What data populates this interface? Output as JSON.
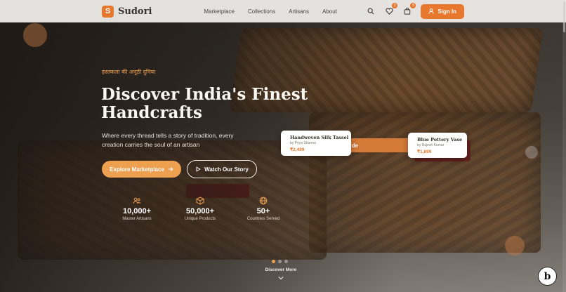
{
  "nav": {
    "logo_letter": "S",
    "brand": "Sudori",
    "links": [
      "Marketplace",
      "Collections",
      "Artisans",
      "About"
    ],
    "wishlist_count": "2",
    "cart_count": "3",
    "signin_label": "Sign In"
  },
  "hero": {
    "eyebrow": "हस्तकला की अनूठी दुनिया",
    "title": "Discover India's Finest Handcrafts",
    "subtitle": "Where every thread tells a story of tradition, every creation carries the soul of an artisan",
    "primary_cta": "Explore Marketplace",
    "secondary_cta": "Watch Our Story",
    "stats": [
      {
        "icon": "artisans-icon",
        "value": "10,000+",
        "label": "Master Artisans"
      },
      {
        "icon": "box-icon",
        "value": "50,000+",
        "label": "Unique Products"
      },
      {
        "icon": "globe-icon",
        "value": "50+",
        "label": "Countries Served"
      }
    ],
    "floating_pill": "de"
  },
  "cards": [
    {
      "title": "Handwoven Silk Tassel",
      "artisan": "by Priya Sharma",
      "price": "₹2,499"
    },
    {
      "title": "Blue Pottery Vase",
      "artisan": "by Rajesh Kumar",
      "price": "₹1,899"
    }
  ],
  "carousel": {
    "slides": 3,
    "active": 0
  },
  "scroll_cue": "Discover More",
  "fab_letter": "b",
  "colors": {
    "accent": "#e8782d",
    "accent_light": "#eca050",
    "eyebrow": "#f0a050",
    "nav_bg": "#eeece9"
  }
}
